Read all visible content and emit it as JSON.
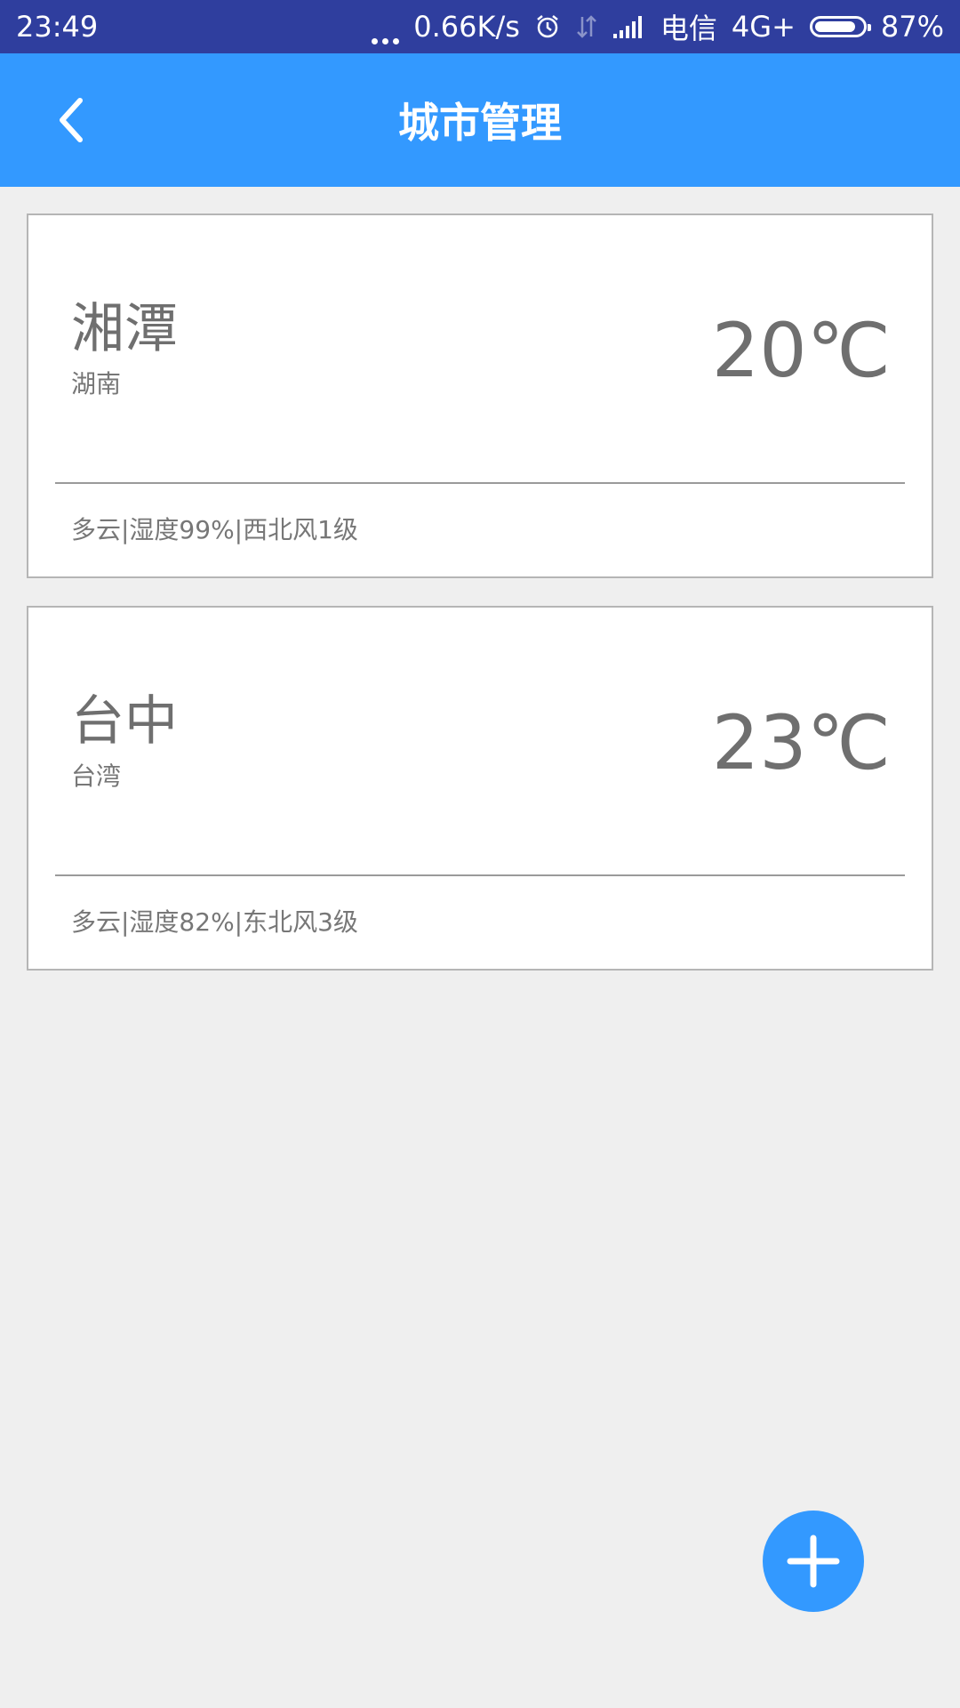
{
  "status_bar": {
    "time": "23:49",
    "network_speed": "0.66K/s",
    "carrier": "电信",
    "network_type": "4G+",
    "battery": "87%",
    "battery_level": 0.87
  },
  "app_bar": {
    "title": "城市管理",
    "background_color": "#3399ff"
  },
  "cities": [
    {
      "name": "湘潭",
      "province": "湖南",
      "temperature": "20℃",
      "detail": "多云|湿度99%|西北风1级"
    },
    {
      "name": "台中",
      "province": "台湾",
      "temperature": "23℃",
      "detail": "多云|湿度82%|东北风3级"
    }
  ],
  "fab": {
    "icon": "plus-icon",
    "color": "#3399ff"
  }
}
